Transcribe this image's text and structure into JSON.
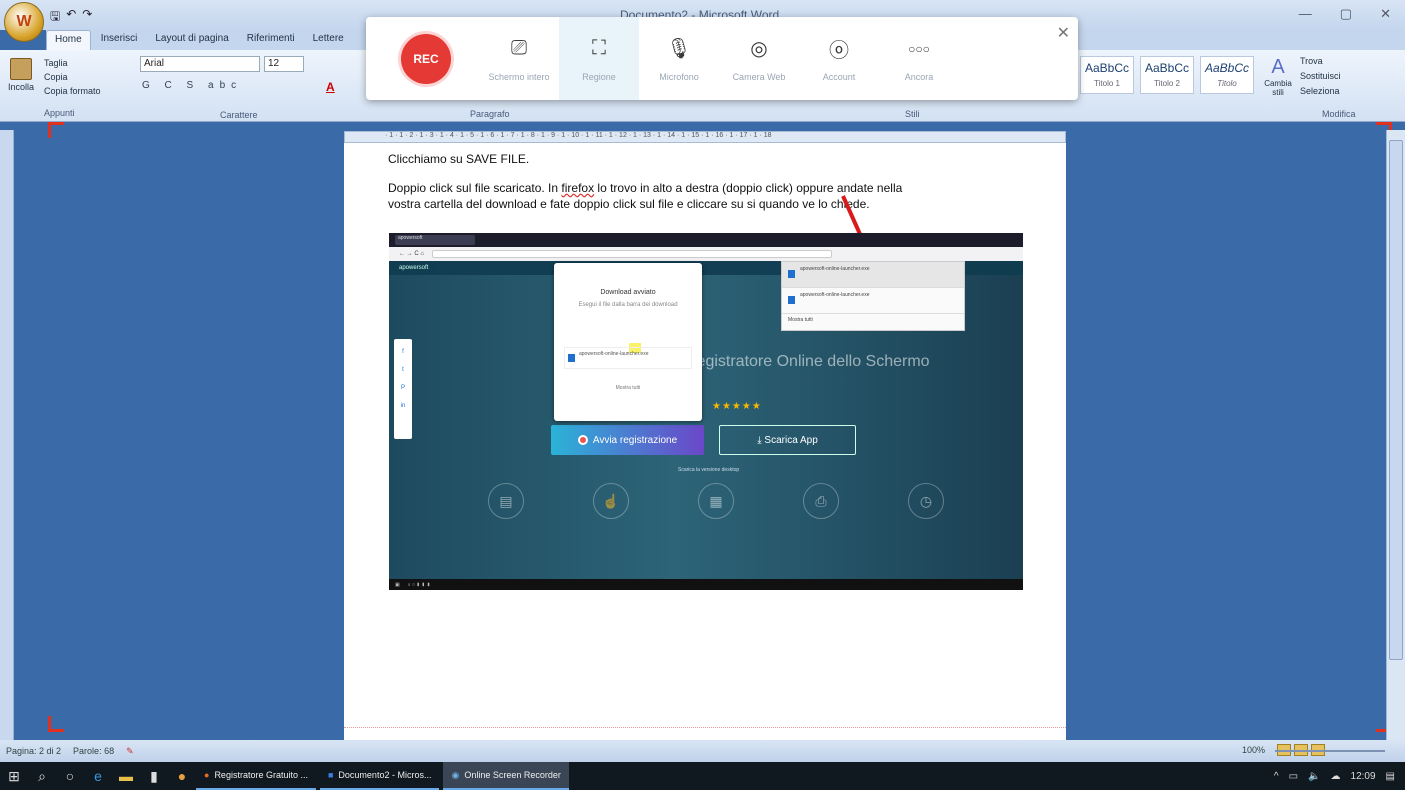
{
  "window": {
    "title": "Documento2 - Microsoft Word",
    "minimize": "—",
    "maximize": "▢",
    "close": "✕"
  },
  "qat": {
    "save": "🖫",
    "undo": "↶",
    "redo": "↷"
  },
  "tabs": [
    "Home",
    "Inserisci",
    "Layout di pagina",
    "Riferimenti",
    "Lettere"
  ],
  "ribbon": {
    "clipboard": {
      "paste": "Incolla",
      "cut": "Taglia",
      "copy": "Copia",
      "format_painter": "Copia formato",
      "label": "Appunti"
    },
    "font": {
      "name": "Arial",
      "size": "12",
      "label": "Carattere"
    },
    "paragraph": {
      "label": "Paragrafo"
    },
    "styles": {
      "label": "Stili",
      "items": [
        {
          "sample": "AaBbCc",
          "name": "Titolo 1"
        },
        {
          "sample": "AaBbCc",
          "name": "Titolo 2"
        },
        {
          "sample": "AaBbCc",
          "name": "Titolo"
        }
      ],
      "change": "Cambia stili"
    },
    "editing": {
      "find": "Trova",
      "replace": "Sostituisci",
      "select": "Seleziona",
      "label": "Modifica"
    }
  },
  "recorder": {
    "rec": "REC",
    "tools": [
      {
        "icon": "screen-icon",
        "glyph": "⎚",
        "label": "Schermo intero",
        "selected": false
      },
      {
        "icon": "region-icon",
        "glyph": "⛶",
        "label": "Regione",
        "selected": true
      },
      {
        "icon": "microphone-icon",
        "glyph": "🎙",
        "label": "Microfono",
        "selected": false
      },
      {
        "icon": "camera-icon",
        "glyph": "◎",
        "label": "Camera Web",
        "selected": false
      },
      {
        "icon": "account-icon",
        "glyph": "ⓞ",
        "label": "Account",
        "selected": false
      },
      {
        "icon": "more-icon",
        "glyph": "○○○",
        "label": "Ancora",
        "selected": false
      }
    ],
    "close": "✕"
  },
  "document": {
    "line1": "Clicchiamo su SAVE FILE.",
    "line2_a": "Doppio click sul file scaricato. In ",
    "line2_link": "firefox",
    "line2_b": " lo trovo in alto a destra (doppio click) oppure andate nella",
    "line3": "vostra cartella del download e fate doppio click sul file e cliccare su si quando ve lo chiede."
  },
  "embedded": {
    "download_title": "Download avviato",
    "download_hint": "Esegui il file dalla barra dei download",
    "file_name": "apowersoft-online-launcher.exe",
    "show_all": "Mostra tutti",
    "hero": "Registratore Online dello Schermo",
    "stars": "★★★★★",
    "btn_record": "Avvia registrazione",
    "btn_download": "Scarica App",
    "desktop_link": "Scarica la versione desktop"
  },
  "statusbar": {
    "page": "Pagina: 2 di 2",
    "words": "Parole: 68",
    "zoom": "100%"
  },
  "taskbar": {
    "apps": [
      {
        "icon": "firefox-icon",
        "label": "Registratore Gratuito ...",
        "active": false
      },
      {
        "icon": "word-icon",
        "label": "Documento2 - Micros...",
        "active": false
      },
      {
        "icon": "recorder-icon",
        "label": "Online Screen Recorder",
        "active": true
      }
    ],
    "time": "12:09"
  }
}
